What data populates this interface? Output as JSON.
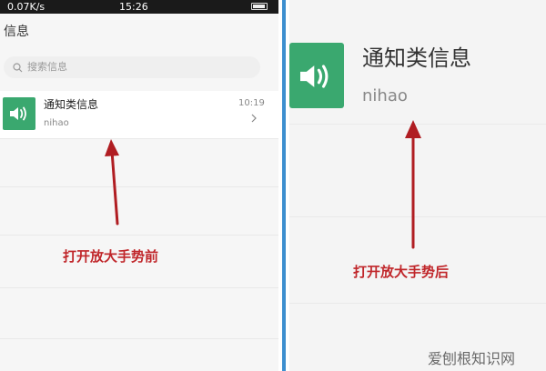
{
  "status_bar": {
    "speed": "0.07K/s",
    "time": "15:26"
  },
  "page_title": "信息",
  "search": {
    "placeholder": "搜索信息"
  },
  "message": {
    "title": "通知类信息",
    "preview": "nihao",
    "time": "10:19",
    "avatar_icon": "speaker-icon",
    "avatar_color": "#3aa86f"
  },
  "captions": {
    "before": "打开放大手势前",
    "after": "打开放大手势后",
    "color": "#c0262a"
  },
  "watermark": "爱刨根知识网",
  "divider_color": "#3d8fcf"
}
